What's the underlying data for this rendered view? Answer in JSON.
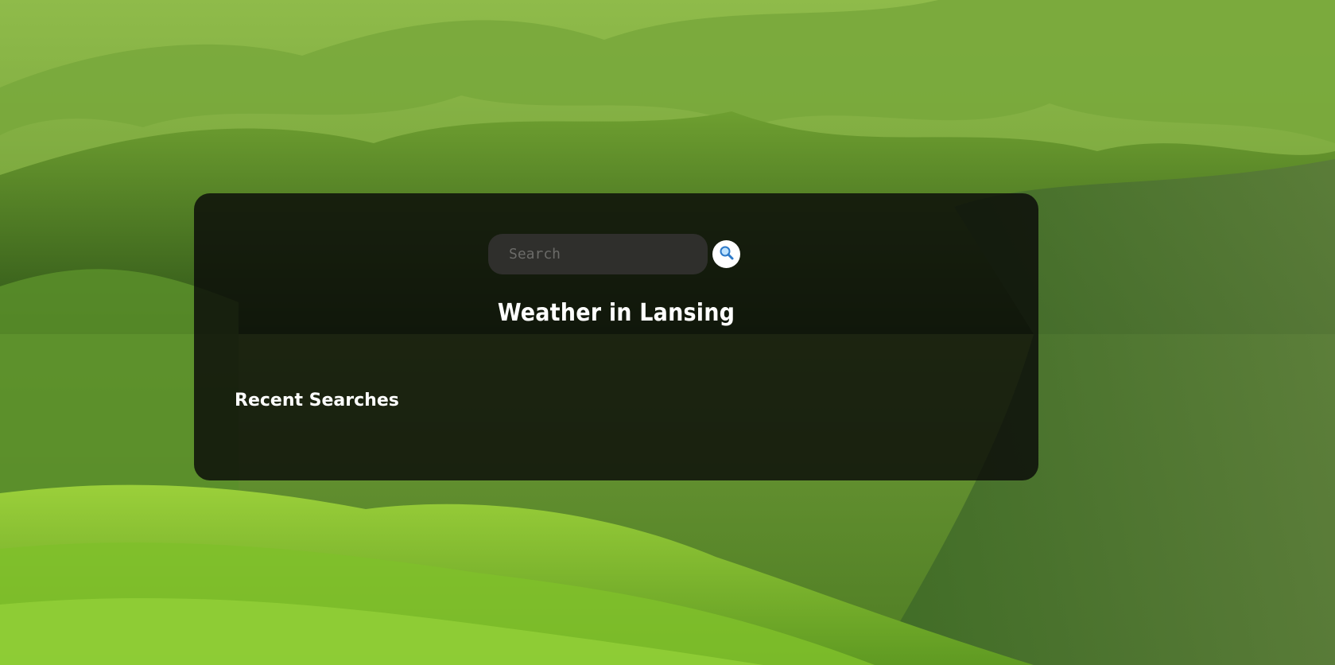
{
  "search": {
    "placeholder": "Search",
    "value": ""
  },
  "weather": {
    "heading": "Weather in Lansing"
  },
  "recent": {
    "heading": "Recent Searches"
  },
  "icons": {
    "search_button_icon": "magnifying-glass-icon"
  },
  "colors": {
    "card_background": "#0a0a08",
    "search_field": "#2f2f2c",
    "search_button": "#ffffff",
    "text": "#ffffff"
  }
}
